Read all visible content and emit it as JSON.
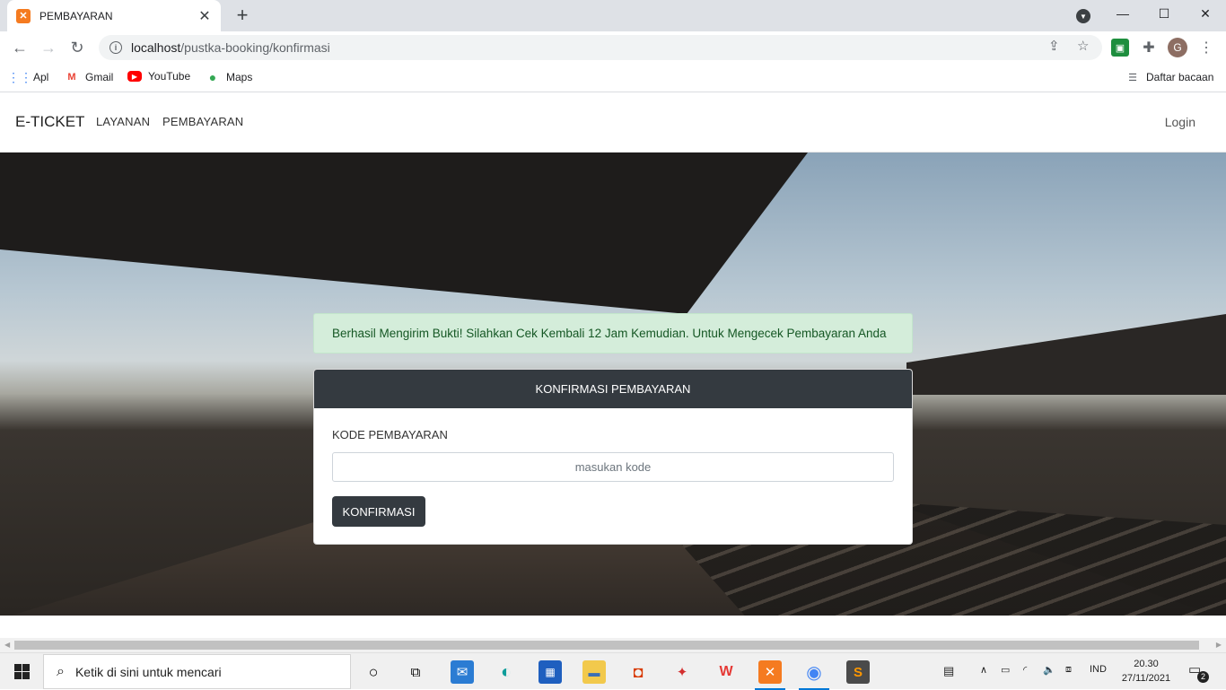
{
  "browser": {
    "tab_title": "PEMBAYARAN",
    "url_host": "localhost",
    "url_path": "/pustka-booking/konfirmasi",
    "profile_initial": "G",
    "bookmarks": [
      {
        "label": "Apl",
        "icon": "apps-grid-icon"
      },
      {
        "label": "Gmail",
        "icon": "gmail-icon"
      },
      {
        "label": "YouTube",
        "icon": "youtube-icon"
      },
      {
        "label": "Maps",
        "icon": "maps-icon"
      }
    ],
    "reading_list": "Daftar bacaan"
  },
  "site": {
    "brand": "E-TICKET",
    "nav": [
      "LAYANAN",
      "PEMBAYARAN"
    ],
    "login": "Login"
  },
  "alert": {
    "message": "Berhasil Mengirim Bukti! Silahkan Cek Kembali 12 Jam Kemudian. Untuk Mengecek Pembayaran Anda"
  },
  "form": {
    "header": "KONFIRMASI PEMBAYARAN",
    "label": "KODE PEMBAYARAN",
    "placeholder": "masukan kode",
    "value": "",
    "button": "KONFIRMASI"
  },
  "taskbar": {
    "search_placeholder": "Ketik di sini untuk mencari",
    "language": "IND",
    "time": "20.30",
    "date": "27/11/2021",
    "notification_count": "2"
  },
  "colors": {
    "dark": "#343a40",
    "alert_bg": "#d4edda",
    "alert_text": "#155724",
    "chrome_frame": "#dee1e6"
  }
}
